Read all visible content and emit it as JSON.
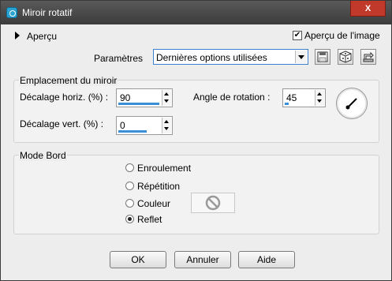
{
  "window": {
    "title": "Miroir rotatif",
    "close_label": "X"
  },
  "preview": {
    "apercu_label": "Aperçu",
    "apercu_image_label": "Aperçu de l'image",
    "apercu_image_checked": true
  },
  "params": {
    "label": "Paramètres",
    "preset_value": "Dernières options utilisées"
  },
  "mirror_group": {
    "legend": "Emplacement du miroir",
    "h_offset_label": "Décalage horiz. (%) :",
    "h_offset_value": "90",
    "v_offset_label": "Décalage vert. (%) :",
    "v_offset_value": "0",
    "angle_label": "Angle de rotation :",
    "angle_value": "45"
  },
  "edge_group": {
    "legend": "Mode Bord",
    "options": [
      {
        "label": "Enroulement",
        "selected": false
      },
      {
        "label": "Répétition",
        "selected": false
      },
      {
        "label": "Couleur",
        "selected": false
      },
      {
        "label": "Reflet",
        "selected": true
      }
    ]
  },
  "buttons": {
    "ok": "OK",
    "cancel": "Annuler",
    "help": "Aide"
  },
  "colors": {
    "accent": "#3b8fd8",
    "close": "#c0392b",
    "titlebar": "#4a4a4a"
  }
}
